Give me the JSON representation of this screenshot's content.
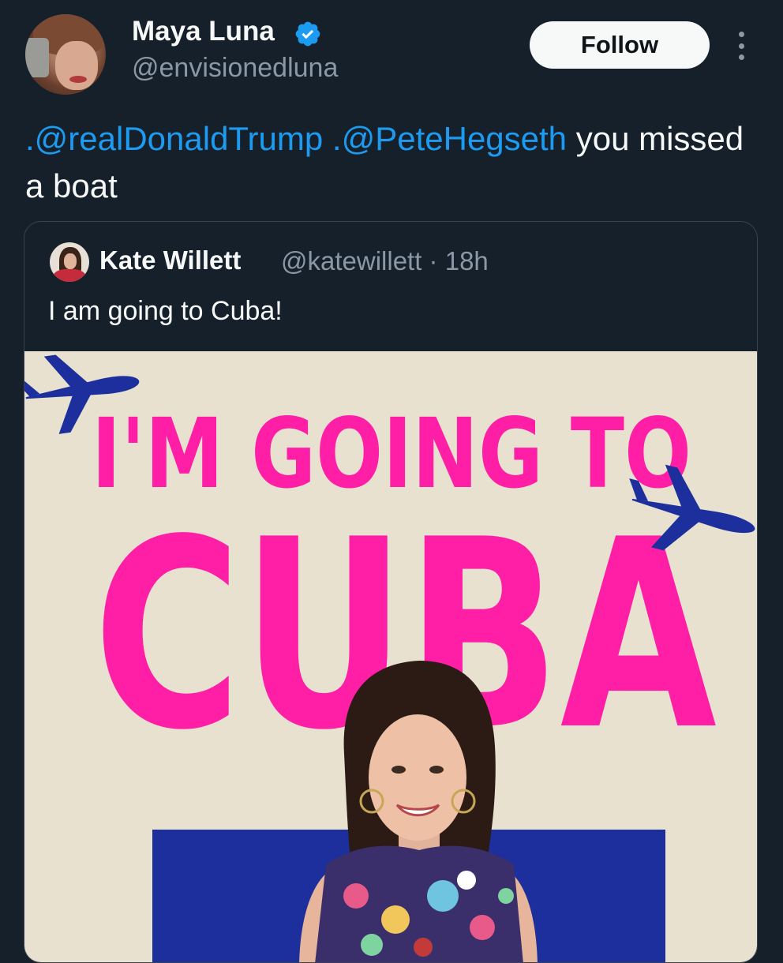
{
  "author": {
    "display_name": "Maya Luna",
    "handle": "@envisionedluna",
    "verified": true,
    "avatar_icon": "profile-photo"
  },
  "actions": {
    "follow_label": "Follow",
    "more_icon": "more-vertical-icon"
  },
  "tweet": {
    "mention1": ".@realDonaldTrump",
    "mention2": ".@PeteHegseth",
    "text_rest": " you missed a boat"
  },
  "quoted": {
    "display_name": "Kate Willett",
    "handle_time": "@katewillett · 18h",
    "text": "I am going to Cuba!",
    "media": {
      "title_line1": "I'M GOING TO",
      "title_line2": "CUBA"
    }
  },
  "colors": {
    "background": "#15202b",
    "link": "#1d9bf0",
    "poster_pink": "#ff1fa6",
    "poster_blue": "#1d2f9c",
    "poster_bg": "#e8e1cf"
  }
}
